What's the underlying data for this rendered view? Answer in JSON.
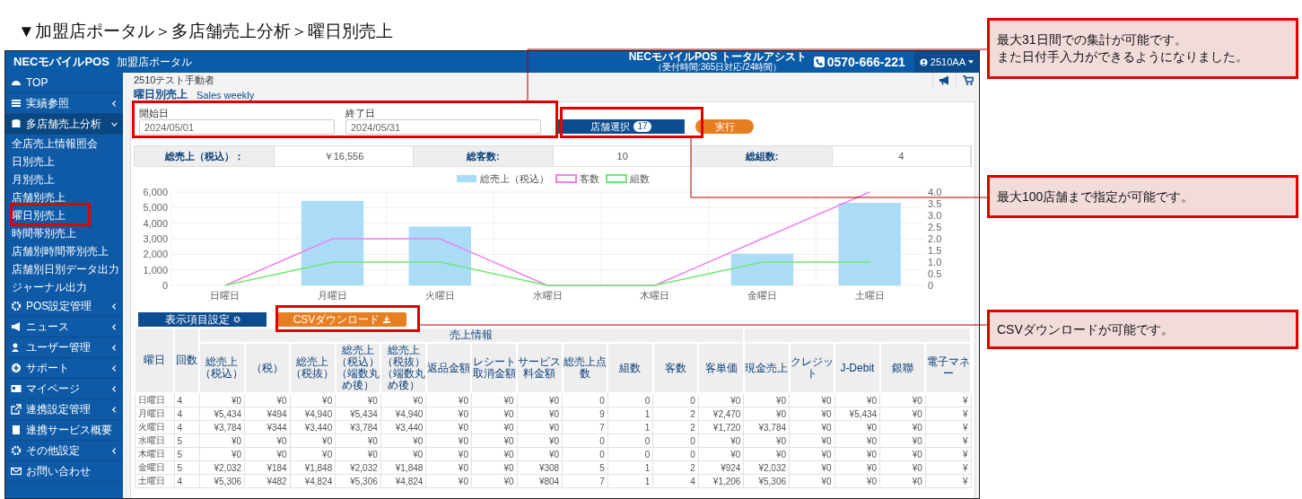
{
  "heading": "▼加盟店ポータル＞多店舗売上分析＞曜日別売上",
  "header": {
    "brand": "NECモバイルPOS",
    "portal": "加盟店ポータル",
    "support_name": "NECモバイルPOS トータルアシスト",
    "support_hours": "（受付時間:365日対応/24時間）",
    "phone": "0570-666-221",
    "user": "2510AA"
  },
  "sidebar": {
    "items": [
      {
        "label": "TOP"
      },
      {
        "label": "実績参照",
        "expanded": false
      },
      {
        "label": "多店舗売上分析",
        "expanded": true,
        "children": [
          {
            "label": "全店売上情報照会"
          },
          {
            "label": "日別売上"
          },
          {
            "label": "月別売上"
          },
          {
            "label": "店舗別売上"
          },
          {
            "label": "曜日別売上"
          },
          {
            "label": "時間帯別売上"
          },
          {
            "label": "店舗別時間帯別売上"
          },
          {
            "label": "店舗別日別データ出力"
          },
          {
            "label": "ジャーナル出力"
          }
        ]
      },
      {
        "label": "POS設定管理",
        "expanded": false
      },
      {
        "label": "ニュース",
        "expanded": false
      },
      {
        "label": "ユーザー管理",
        "expanded": false
      },
      {
        "label": "サポート",
        "expanded": false
      },
      {
        "label": "マイページ",
        "expanded": false
      },
      {
        "label": "連携設定管理",
        "expanded": false
      },
      {
        "label": "連携サービス概要"
      },
      {
        "label": "その他設定",
        "expanded": false
      },
      {
        "label": "お問い合わせ"
      }
    ]
  },
  "breadcrumb": "2510テスト手動者",
  "page_title": "曜日別売上",
  "page_subtitle": "Sales weekly",
  "filters": {
    "start_label": "開始日",
    "start_value": "2024/05/01",
    "end_label": "終了日",
    "end_value": "2024/05/31",
    "store_button": "店舗選択",
    "store_count": "17",
    "run_button": "実行"
  },
  "summary": [
    {
      "label": "総売上（税込）：",
      "value": "￥16,556"
    },
    {
      "label": "総客数:",
      "value": "10"
    },
    {
      "label": "総組数:",
      "value": "4"
    }
  ],
  "chart": {
    "chart_data": {
      "type": "bar",
      "categories": [
        "日曜日",
        "月曜日",
        "火曜日",
        "水曜日",
        "木曜日",
        "金曜日",
        "土曜日"
      ],
      "series": [
        {
          "name": "総売上（税込）",
          "color": "#aadcf8",
          "values": [
            0,
            5434,
            3784,
            0,
            0,
            2032,
            5306
          ]
        },
        {
          "name": "客数",
          "color": "#f080f0",
          "type": "line",
          "axis": "y2",
          "values": [
            0,
            2,
            2,
            0,
            0,
            2,
            4
          ]
        },
        {
          "name": "組数",
          "color": "#70e870",
          "type": "line",
          "axis": "y2",
          "values": [
            0,
            1,
            1,
            0,
            0,
            1,
            1
          ]
        }
      ],
      "grid": true,
      "legend": "top",
      "ylim": [
        0,
        6000
      ],
      "yticks": [
        {
          "value": 0,
          "label": "0"
        },
        {
          "value": 1000,
          "label": "1,000"
        },
        {
          "value": 2000,
          "label": "2,000"
        },
        {
          "value": 3000,
          "label": "3,000"
        },
        {
          "value": 4000,
          "label": "4,000"
        },
        {
          "value": 5000,
          "label": "5,000"
        },
        {
          "value": 6000,
          "label": "6,000"
        }
      ],
      "y2lim": [
        0,
        4
      ],
      "y2ticks": [
        {
          "value": 0,
          "label": "0"
        },
        {
          "value": 0.5,
          "label": "0.5"
        },
        {
          "value": 1,
          "label": "1.0"
        },
        {
          "value": 1.5,
          "label": "1.5"
        },
        {
          "value": 2,
          "label": "2.0"
        },
        {
          "value": 2.5,
          "label": "2.5"
        },
        {
          "value": 3,
          "label": "3.0"
        },
        {
          "value": 3.5,
          "label": "3.5"
        },
        {
          "value": 4,
          "label": "4.0"
        }
      ]
    }
  },
  "actions": {
    "columns_button": "表示項目設定",
    "csv_button": "CSVダウンロード"
  },
  "table": {
    "columns": [
      "曜日",
      "回数"
    ],
    "groups": [
      {
        "label": "売上情報",
        "columns": [
          "総売上（税込）",
          "（税）",
          "総売上（税抜）",
          "総売上（税込）（端数丸め後）",
          "総売上（税抜）（端数丸め後）",
          "返品金額",
          "レシート取消金額",
          "サービス料金額",
          "総売上点数",
          "組数",
          "客数",
          "客単価"
        ]
      },
      {
        "columns": [
          "現金売上",
          "クレジット",
          "J-Debit",
          "銀聯",
          "電子マネー"
        ]
      }
    ],
    "rows": [
      [
        "日曜日",
        "4",
        "¥0",
        "¥0",
        "¥0",
        "¥0",
        "¥0",
        "¥0",
        "¥0",
        "¥0",
        "0",
        "0",
        "0",
        "¥0",
        "¥0",
        "¥0",
        "¥0",
        "¥0",
        "¥"
      ],
      [
        "月曜日",
        "4",
        "¥5,434",
        "¥494",
        "¥4,940",
        "¥5,434",
        "¥4,940",
        "¥0",
        "¥0",
        "¥0",
        "9",
        "1",
        "2",
        "¥2,470",
        "¥0",
        "¥0",
        "¥5,434",
        "¥0",
        "¥"
      ],
      [
        "火曜日",
        "4",
        "¥3,784",
        "¥344",
        "¥3,440",
        "¥3,784",
        "¥3,440",
        "¥0",
        "¥0",
        "¥0",
        "7",
        "1",
        "2",
        "¥1,720",
        "¥3,784",
        "¥0",
        "¥0",
        "¥0",
        "¥"
      ],
      [
        "水曜日",
        "5",
        "¥0",
        "¥0",
        "¥0",
        "¥0",
        "¥0",
        "¥0",
        "¥0",
        "¥0",
        "0",
        "0",
        "0",
        "¥0",
        "¥0",
        "¥0",
        "¥0",
        "¥0",
        "¥"
      ],
      [
        "木曜日",
        "5",
        "¥0",
        "¥0",
        "¥0",
        "¥0",
        "¥0",
        "¥0",
        "¥0",
        "¥0",
        "0",
        "0",
        "0",
        "¥0",
        "¥0",
        "¥0",
        "¥0",
        "¥0",
        "¥"
      ],
      [
        "金曜日",
        "5",
        "¥2,032",
        "¥184",
        "¥1,848",
        "¥2,032",
        "¥1,848",
        "¥0",
        "¥0",
        "¥308",
        "5",
        "1",
        "2",
        "¥924",
        "¥2,032",
        "¥0",
        "¥0",
        "¥0",
        "¥"
      ],
      [
        "土曜日",
        "4",
        "¥5,306",
        "¥482",
        "¥4,824",
        "¥5,306",
        "¥4,824",
        "¥0",
        "¥0",
        "¥804",
        "7",
        "1",
        "4",
        "¥1,206",
        "¥5,306",
        "¥0",
        "¥0",
        "¥0",
        "¥"
      ]
    ]
  },
  "callouts": [
    {
      "lines": [
        "最大31日間での集計が可能です。",
        "また日付手入力ができるようになりました。"
      ]
    },
    {
      "lines": [
        "最大100店舗まで指定が可能です。"
      ]
    },
    {
      "lines": [
        "CSVダウンロードが可能です。"
      ]
    }
  ]
}
